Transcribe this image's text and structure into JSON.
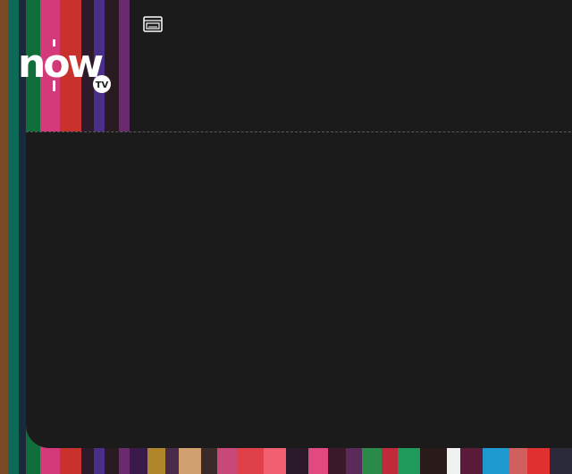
{
  "brand": {
    "logo_text": "now",
    "logo_badge": "TV",
    "logo_color": "#ffffff",
    "badge_color": "#1b1b1b"
  },
  "toolbar": {
    "pip_icon": "picture-in-picture-icon"
  },
  "background": {
    "panel_color": "#1b1b1b",
    "stripe_palette": [
      "#7a4a2a",
      "#0f6e5a",
      "#d33a78",
      "#c7342f",
      "#3a2f7a",
      "#5e2a8a",
      "#1a3e8f",
      "#2a7a4a",
      "#e04a3a",
      "#1ea0d0",
      "#b0862a",
      "#6a2a6a"
    ]
  }
}
